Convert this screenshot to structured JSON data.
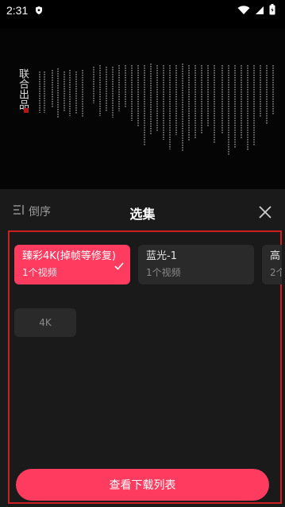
{
  "status": {
    "time": "2:31",
    "icons": [
      "shield-icon",
      "wifi-icon",
      "signal-icon",
      "battery-icon"
    ]
  },
  "video": {
    "title_vertical": "联合出品",
    "body_text": "Vertical columns of Chinese credit text on a black background"
  },
  "sheet": {
    "sort_label": "倒序",
    "title": "选集",
    "cards": [
      {
        "title": "臻彩4K(掉帧等修复)",
        "sub": "1个视频",
        "selected": true
      },
      {
        "title": "蓝光-1",
        "sub": "1个视频",
        "selected": false
      },
      {
        "title": "高",
        "sub": "2个",
        "selected": false
      }
    ],
    "quality_chip": "4K",
    "download_button": "查看下载列表"
  },
  "colors": {
    "accent": "#ff3c5f",
    "sheet_bg": "#1a1a1a",
    "card_bg": "#2a2a2a",
    "highlight_border": "#cc1f1f"
  }
}
